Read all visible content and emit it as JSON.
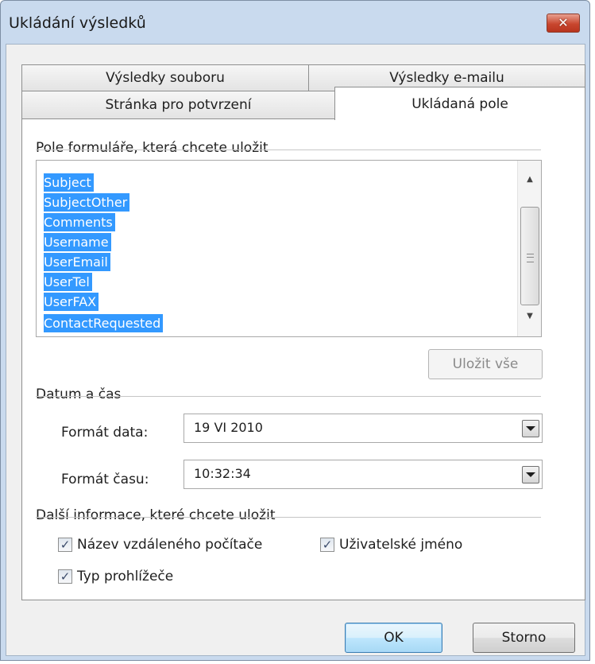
{
  "window": {
    "title": "Ukládání výsledků"
  },
  "tabs": {
    "row1": [
      "Výsledky souboru",
      "Výsledky e-mailu"
    ],
    "row2": [
      "Stránka pro potvrzení",
      "Ukládaná pole"
    ],
    "active": "Ukládaná pole"
  },
  "fields_group": {
    "label": "Pole formuláře, která chcete uložit",
    "items": [
      "Subject",
      "SubjectOther",
      "Comments",
      "Username",
      "UserEmail",
      "UserTel",
      "UserFAX",
      "ContactRequested"
    ],
    "save_all": "Uložit vše"
  },
  "datetime_group": {
    "label": "Datum a čas",
    "date_label": "Formát data:",
    "date_value": "19 VI 2010",
    "time_label": "Formát času:",
    "time_value": "10:32:34"
  },
  "extra_group": {
    "label": "Další informace, které chcete uložit",
    "remote_computer": {
      "label": "Název vzdáleného počítače",
      "checked": true
    },
    "username": {
      "label": "Uživatelské jméno",
      "checked": true
    },
    "browser": {
      "label": "Typ prohlížeče",
      "checked": true
    }
  },
  "buttons": {
    "ok": "OK",
    "cancel": "Storno"
  },
  "icons": {
    "close": "close-icon",
    "check": "checkmark-icon",
    "dropdown": "chevron-down-icon"
  },
  "colors": {
    "selection": "#3399ff",
    "title_bar": "#c9daee",
    "close_button": "#c9472f"
  }
}
